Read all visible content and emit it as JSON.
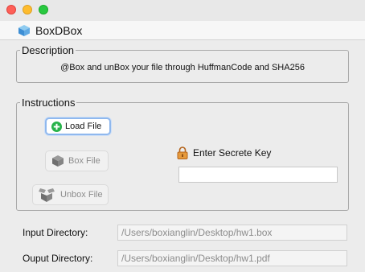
{
  "window": {
    "title": "BoxDBox"
  },
  "description": {
    "legend": "Description",
    "text": "@Box and unBox your file through HuffmanCode and SHA256"
  },
  "instructions": {
    "legend": "Instructions",
    "load_label": "Load File",
    "box_label": "Box File",
    "unbox_label": "Unbox File",
    "key_label": "Enter Secrete Key",
    "key_value": ""
  },
  "directories": {
    "input_label": "Input Directory:",
    "input_value": "/Users/boxianglin/Desktop/hw1.box",
    "output_label": "Ouput Directory:",
    "output_value": "/Users/boxianglin/Desktop/hw1.pdf"
  },
  "icons": {
    "app": "box-app-icon",
    "load": "plus-circle-icon",
    "box": "box-icon",
    "unbox": "unbox-icon",
    "lock": "lock-icon"
  },
  "colors": {
    "close": "#fe5f57",
    "minimize": "#febc2e",
    "maximize": "#28c840",
    "load_icon": "#27b24a",
    "focus_ring": "#8fb8ee",
    "lock": "#d9822b"
  }
}
